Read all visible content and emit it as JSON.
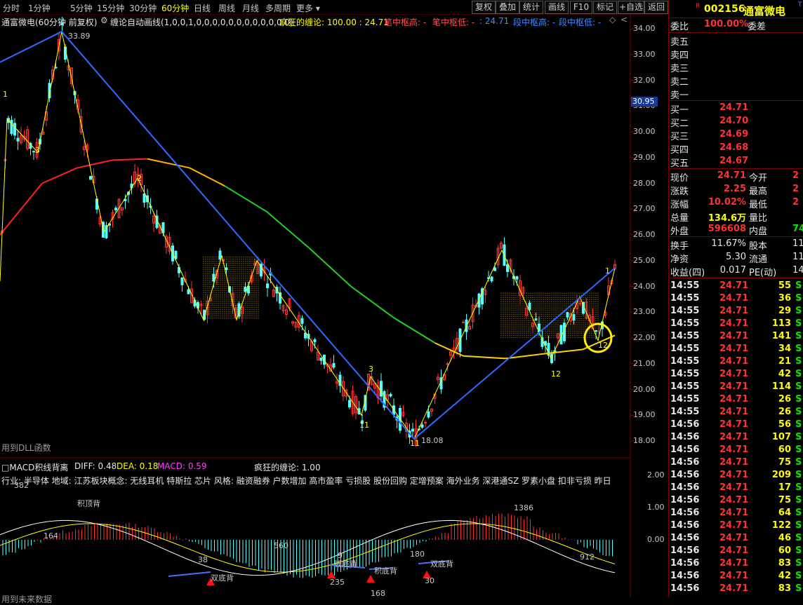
{
  "toolbar": {
    "periods": [
      "分时",
      "1分钟",
      "5分钟",
      "15分钟",
      "30分钟",
      "60分钟",
      "日线",
      "周线",
      "月线",
      "多周期",
      "更多"
    ],
    "active_period": "60分钟",
    "buttons": [
      "复权",
      "叠加",
      "统计",
      "画线",
      "F10",
      "标记",
      "+自选",
      "返回"
    ]
  },
  "chart_header": {
    "title": "通富微电(60分钟 前复权)",
    "indicator": "缠论自动画线(1,0,0,1,0,0,0,0,0,0,0,0,0,0,0,0)",
    "crazy": "疯狂的缠论: 100.00 : 24.71",
    "pen_high": "笔中枢高: -",
    "pen_low": "笔中枢低: -",
    "val2": ": 24.71",
    "seg_high": "段中枢高: -",
    "seg_low": "段中枢低: -",
    "swatch_char": "◇"
  },
  "y_axis": {
    "labels": [
      "34.00",
      "33.00",
      "32.00",
      "31.00",
      "30.00",
      "29.00",
      "28.00",
      "27.00",
      "26.00",
      "25.00",
      "24.00",
      "23.00",
      "22.00",
      "21.00",
      "20.00",
      "19.00",
      "18.00"
    ],
    "current_price_tag": "30.95",
    "macd_labels": [
      "2.00",
      "1.00",
      "0.00"
    ]
  },
  "chart_annotations": {
    "high_price": "33.89",
    "low_price": "18.08",
    "pen_labels": [
      "3",
      "2",
      "11",
      "3",
      "11",
      "1",
      "12",
      "1",
      "12"
    ],
    "dll_text": "用到DLL函数",
    "bottom_text": "用到未来数据"
  },
  "macd_header": {
    "name": "MACD积线背离",
    "diff": "DIFF: 0.48",
    "dea": "DEA: 0.18",
    "macd": "MACD: 0.59",
    "crazy": "疯狂的缠论: 1.00"
  },
  "industry_line": "行业: 半导体      地域: 江苏板块概念: 无线耳机 特斯拉 芯片 风格: 融资融券 户数增加 高市盈率 亏损股 股份回购 定增预案 海外业务 深港通SZ 罗素小盘 扣非亏损 昨日",
  "macd_annotations": {
    "top_div": "积顶背",
    "bottom_divs": [
      "双底背",
      "钱底背",
      "积底背",
      "双底背"
    ],
    "numbers": [
      "382",
      "164",
      "38",
      "560",
      "9",
      "235",
      "180",
      "30",
      "168",
      "1386",
      "912"
    ]
  },
  "panel": {
    "code": "002156",
    "name": "通富微电",
    "ratio_label": "委比",
    "ratio_value": "100.00%",
    "diff_label": "委差",
    "sells": [
      "卖五",
      "卖四",
      "卖三",
      "卖二",
      "卖一"
    ],
    "buys": [
      {
        "label": "买一",
        "price": "24.71"
      },
      {
        "label": "买二",
        "price": "24.70"
      },
      {
        "label": "买三",
        "price": "24.69"
      },
      {
        "label": "买四",
        "price": "24.68"
      },
      {
        "label": "买五",
        "price": "24.67"
      }
    ],
    "stats_left": [
      {
        "label": "现价",
        "value": "24.71"
      },
      {
        "label": "涨跌",
        "value": "2.25"
      },
      {
        "label": "涨幅",
        "value": "10.02%"
      },
      {
        "label": "总量",
        "value": "134.6万"
      },
      {
        "label": "外盘",
        "value": "596608"
      }
    ],
    "stats_right": [
      {
        "label": "今开",
        "value": "2"
      },
      {
        "label": "最高",
        "value": "2"
      },
      {
        "label": "最低",
        "value": "2"
      },
      {
        "label": "量比",
        "value": ""
      },
      {
        "label": "内盘",
        "value": "74"
      }
    ],
    "stats2": [
      {
        "l1": "换手",
        "v1": "11.67%",
        "l2": "股本",
        "v2": "11"
      },
      {
        "l1": "净资",
        "v1": "5.30",
        "l2": "流通",
        "v2": "11"
      },
      {
        "l1": "收益(四)",
        "v1": "0.017",
        "l2": "PE(动)",
        "v2": "14"
      }
    ],
    "ticks": [
      {
        "t": "14:55",
        "p": "24.71",
        "v": "55"
      },
      {
        "t": "14:55",
        "p": "24.71",
        "v": "36"
      },
      {
        "t": "14:55",
        "p": "24.71",
        "v": "29"
      },
      {
        "t": "14:55",
        "p": "24.71",
        "v": "113"
      },
      {
        "t": "14:55",
        "p": "24.71",
        "v": "141"
      },
      {
        "t": "14:55",
        "p": "24.71",
        "v": "34"
      },
      {
        "t": "14:55",
        "p": "24.71",
        "v": "21"
      },
      {
        "t": "14:55",
        "p": "24.71",
        "v": "42"
      },
      {
        "t": "14:55",
        "p": "24.71",
        "v": "114"
      },
      {
        "t": "14:55",
        "p": "24.71",
        "v": "26"
      },
      {
        "t": "14:55",
        "p": "24.71",
        "v": "26"
      },
      {
        "t": "14:56",
        "p": "24.71",
        "v": "56"
      },
      {
        "t": "14:56",
        "p": "24.71",
        "v": "107"
      },
      {
        "t": "14:56",
        "p": "24.71",
        "v": "60"
      },
      {
        "t": "14:56",
        "p": "24.71",
        "v": "75"
      },
      {
        "t": "14:56",
        "p": "24.71",
        "v": "209"
      },
      {
        "t": "14:56",
        "p": "24.71",
        "v": "17"
      },
      {
        "t": "14:56",
        "p": "24.71",
        "v": "75"
      },
      {
        "t": "14:56",
        "p": "24.71",
        "v": "64"
      },
      {
        "t": "14:56",
        "p": "24.71",
        "v": "122"
      },
      {
        "t": "14:56",
        "p": "24.71",
        "v": "46"
      },
      {
        "t": "14:56",
        "p": "24.71",
        "v": "60"
      },
      {
        "t": "14:56",
        "p": "24.71",
        "v": "83"
      },
      {
        "t": "14:56",
        "p": "24.71",
        "v": "42"
      },
      {
        "t": "14:56",
        "p": "24.71",
        "v": "83"
      }
    ],
    "tick_side": "S"
  },
  "colors": {
    "up": "#ff3232",
    "down": "#54ffff",
    "ma": "#ff2020",
    "bi": "#ffff00",
    "segment": "#2b6cff",
    "background": "#000000"
  }
}
